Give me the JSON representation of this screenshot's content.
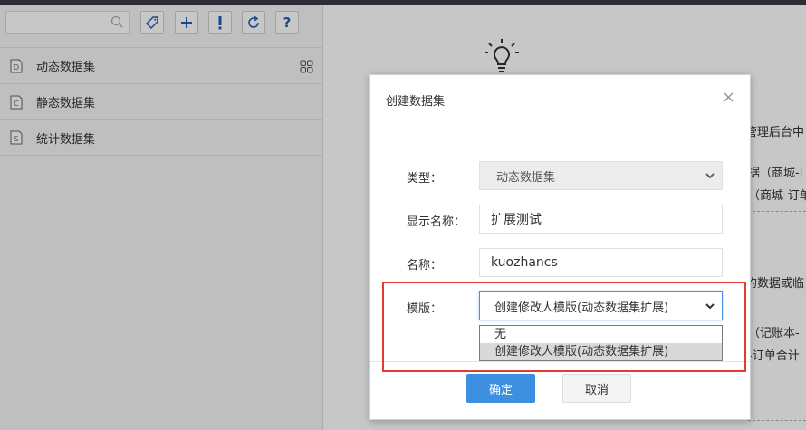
{
  "toolbar": {
    "search_placeholder": "",
    "icons": [
      "search-icon",
      "tag-icon",
      "add-icon",
      "alert-icon",
      "refresh-icon",
      "help-icon"
    ]
  },
  "sidebar": {
    "items": [
      {
        "label": "动态数据集",
        "badge": "D"
      },
      {
        "label": "静态数据集",
        "badge": "C"
      },
      {
        "label": "统计数据集",
        "badge": "S"
      }
    ]
  },
  "background_text": [
    "管理后台中",
    "据（商城-i",
    "（商城-订单",
    "的数据或临",
    "（记账本-",
    "-订单合计"
  ],
  "modal": {
    "title": "创建数据集",
    "close": "×",
    "type_label": "类型：",
    "type_value": "动态数据集",
    "display_name_label": "显示名称：",
    "display_name_value": "扩展测试",
    "name_label": "名称：",
    "name_value": "kuozhancs",
    "template_label": "模版：",
    "template_value": "创建修改人模版(动态数据集扩展)",
    "template_options": [
      "无",
      "创建修改人模版(动态数据集扩展)"
    ],
    "ok_label": "确定",
    "cancel_label": "取消"
  },
  "colors": {
    "accent": "#3d8fe0",
    "highlight": "#e53935",
    "icon_blue": "#1f5fb4"
  }
}
